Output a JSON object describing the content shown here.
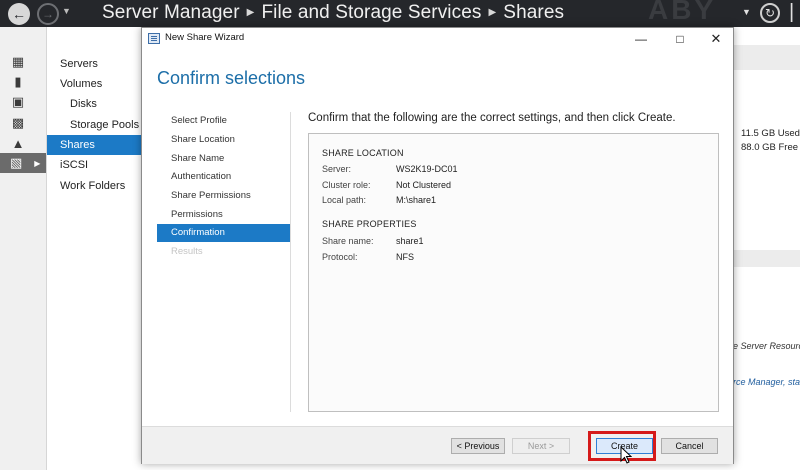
{
  "window": {
    "breadcrumb": [
      "Server Manager",
      "File and Storage Services",
      "Shares"
    ],
    "ghost_text": "ABY"
  },
  "nav": {
    "items": [
      {
        "label": "Servers",
        "level": 0,
        "selected": false
      },
      {
        "label": "Volumes",
        "level": 0,
        "selected": false
      },
      {
        "label": "Disks",
        "level": 1,
        "selected": false
      },
      {
        "label": "Storage Pools",
        "level": 1,
        "selected": false
      },
      {
        "label": "Shares",
        "level": 0,
        "selected": true
      },
      {
        "label": "iSCSI",
        "level": 0,
        "selected": false
      },
      {
        "label": "Work Folders",
        "level": 0,
        "selected": false
      }
    ]
  },
  "right_pane": {
    "used": "11.5 GB Used S",
    "free": "88.0 GB Free Sp",
    "note": "e Server Resourc",
    "link": "rce Manager, sta"
  },
  "wizard": {
    "title": "New Share Wizard",
    "heading": "Confirm selections",
    "steps": [
      {
        "label": "Select Profile",
        "state": "normal"
      },
      {
        "label": "Share Location",
        "state": "normal"
      },
      {
        "label": "Share Name",
        "state": "normal"
      },
      {
        "label": "Authentication",
        "state": "normal"
      },
      {
        "label": "Share Permissions",
        "state": "normal"
      },
      {
        "label": "Permissions",
        "state": "normal"
      },
      {
        "label": "Confirmation",
        "state": "current"
      },
      {
        "label": "Results",
        "state": "disabled"
      }
    ],
    "description": "Confirm that the following are the correct settings, and then click Create.",
    "share_location": {
      "heading": "SHARE LOCATION",
      "server_label": "Server:",
      "server_value": "WS2K19-DC01",
      "cluster_label": "Cluster role:",
      "cluster_value": "Not Clustered",
      "path_label": "Local path:",
      "path_value": "M:\\share1"
    },
    "share_properties": {
      "heading": "SHARE PROPERTIES",
      "name_label": "Share name:",
      "name_value": "share1",
      "protocol_label": "Protocol:",
      "protocol_value": "NFS"
    },
    "buttons": {
      "previous": "< Previous",
      "next": "Next >",
      "create": "Create",
      "cancel": "Cancel"
    }
  },
  "colors": {
    "accent": "#1c7ac6",
    "highlight": "#d51a1a",
    "titlebar": "#25272b"
  }
}
